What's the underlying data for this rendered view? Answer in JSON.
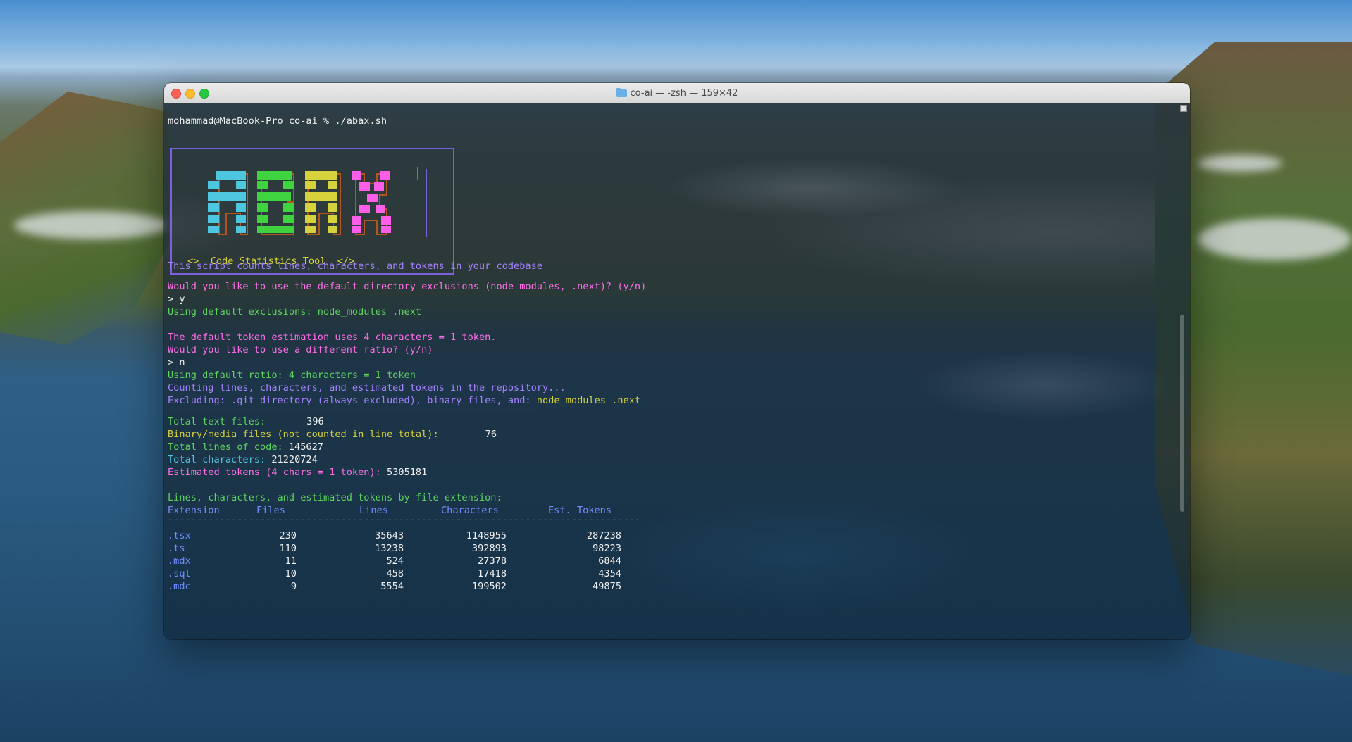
{
  "window": {
    "title": "co-ai — -zsh — 159×42"
  },
  "terminal": {
    "prompt": "mohammad@MacBook-Pro co-ai % ./abax.sh",
    "banner_subtitle": "<>  Code Statistics Tool  </>",
    "intro": "This script counts lines, characters, and tokens in your codebase",
    "separator": "----------------------------------------------------------------",
    "q_exclusions": "Would you like to use the default directory exclusions (node_modules, .next)? (y/n)",
    "a_exclusions": "> y",
    "using_exclusions_label": "Using default exclusions: node_modules .next",
    "token_info": "The default token estimation uses 4 characters = 1 token.",
    "q_ratio": "Would you like to use a different ratio? (y/n)",
    "a_ratio": "> n",
    "using_ratio": "Using default ratio: 4 characters = 1 token",
    "counting": "Counting lines, characters, and estimated tokens in the repository...",
    "excluding_prefix": "Excluding: .git directory (always excluded), binary files, and: ",
    "excluding_dirs": "node_modules .next",
    "separator2": "----------------------------------------------------------------",
    "stats": {
      "text_files_label": "Total text files:",
      "text_files_value": "396",
      "binary_label": "Binary/media files (not counted in line total):",
      "binary_value": "76",
      "lines_label": "Total lines of code:",
      "lines_value": "145627",
      "chars_label": "Total characters:",
      "chars_value": "21220724",
      "tokens_label": "Estimated tokens (4 chars = 1 token):",
      "tokens_value": "5305181"
    },
    "table_title": "Lines, characters, and estimated tokens by file extension:",
    "table_header": {
      "extension": "Extension",
      "files": "Files",
      "lines": "Lines",
      "characters": "Characters",
      "tokens": "Est. Tokens"
    },
    "table_separator": "----------------------------------------------------------------------------------",
    "rows": [
      {
        "ext": ".tsx",
        "files": "230",
        "lines": "35643",
        "chars": "1148955",
        "tokens": "287238"
      },
      {
        "ext": ".ts",
        "files": "110",
        "lines": "13238",
        "chars": "392893",
        "tokens": "98223"
      },
      {
        "ext": ".mdx",
        "files": "11",
        "lines": "524",
        "chars": "27378",
        "tokens": "6844"
      },
      {
        "ext": ".sql",
        "files": "10",
        "lines": "458",
        "chars": "17418",
        "tokens": "4354"
      },
      {
        "ext": ".mdc",
        "files": "9",
        "lines": "5554",
        "chars": "199502",
        "tokens": "49875"
      }
    ]
  },
  "colors": {
    "logo_a": "#4fc6e0",
    "logo_b": "#3fd43f",
    "logo_c": "#d6d23c",
    "logo_x": "#ff5ee8",
    "logo_shadow": "#b5561e",
    "border": "#7a5fe0"
  }
}
